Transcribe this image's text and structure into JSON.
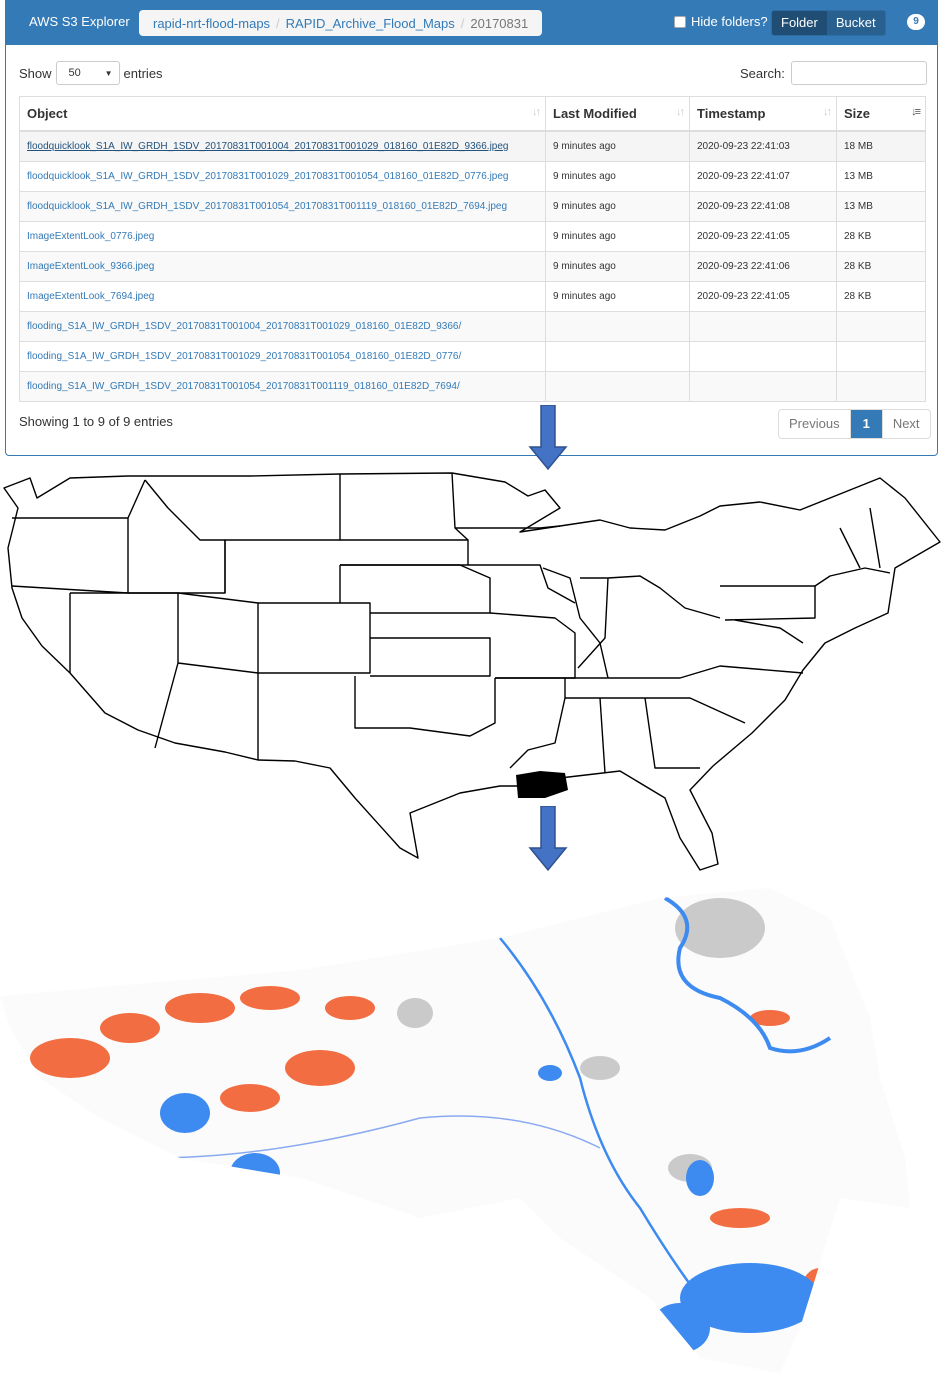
{
  "app": {
    "brand": "AWS S3 Explorer"
  },
  "breadcrumb": [
    "rapid-nrt-flood-maps",
    "RAPID_Archive_Flood_Maps",
    "20170831"
  ],
  "toolbar": {
    "hide_folders_label": "Hide folders?",
    "hide_folders_checked": false,
    "folder_label": "Folder",
    "bucket_label": "Bucket",
    "badge_count": "9"
  },
  "length": {
    "show_label": "Show",
    "value": "50",
    "entries_label": "entries"
  },
  "search": {
    "label": "Search:",
    "value": ""
  },
  "table": {
    "columns": [
      "Object",
      "Last Modified",
      "Timestamp",
      "Size"
    ],
    "rows": [
      {
        "object": "floodquicklook_S1A_IW_GRDH_1SDV_20170831T001004_20170831T001029_018160_01E82D_9366.jpeg",
        "modified": "9 minutes ago",
        "timestamp": "2020-09-23 22:41:03",
        "size": "18 MB"
      },
      {
        "object": "floodquicklook_S1A_IW_GRDH_1SDV_20170831T001029_20170831T001054_018160_01E82D_0776.jpeg",
        "modified": "9 minutes ago",
        "timestamp": "2020-09-23 22:41:07",
        "size": "13 MB"
      },
      {
        "object": "floodquicklook_S1A_IW_GRDH_1SDV_20170831T001054_20170831T001119_018160_01E82D_7694.jpeg",
        "modified": "9 minutes ago",
        "timestamp": "2020-09-23 22:41:08",
        "size": "13 MB"
      },
      {
        "object": "ImageExtentLook_0776.jpeg",
        "modified": "9 minutes ago",
        "timestamp": "2020-09-23 22:41:05",
        "size": "28 KB"
      },
      {
        "object": "ImageExtentLook_9366.jpeg",
        "modified": "9 minutes ago",
        "timestamp": "2020-09-23 22:41:06",
        "size": "28 KB"
      },
      {
        "object": "ImageExtentLook_7694.jpeg",
        "modified": "9 minutes ago",
        "timestamp": "2020-09-23 22:41:05",
        "size": "28 KB"
      },
      {
        "object": "flooding_S1A_IW_GRDH_1SDV_20170831T001004_20170831T001029_018160_01E82D_9366/",
        "modified": "",
        "timestamp": "",
        "size": ""
      },
      {
        "object": "flooding_S1A_IW_GRDH_1SDV_20170831T001029_20170831T001054_018160_01E82D_0776/",
        "modified": "",
        "timestamp": "",
        "size": ""
      },
      {
        "object": "flooding_S1A_IW_GRDH_1SDV_20170831T001054_20170831T001119_018160_01E82D_7694/",
        "modified": "",
        "timestamp": "",
        "size": ""
      }
    ]
  },
  "footer": {
    "info": "Showing 1 to 9 of 9 entries",
    "previous": "Previous",
    "page": "1",
    "next": "Next"
  },
  "colors": {
    "primary": "#337ab7",
    "arrow": "#4472c4",
    "flood_red": "#f04a14",
    "water_blue": "#3d8af0",
    "urban_grey": "#b5b5b5"
  }
}
